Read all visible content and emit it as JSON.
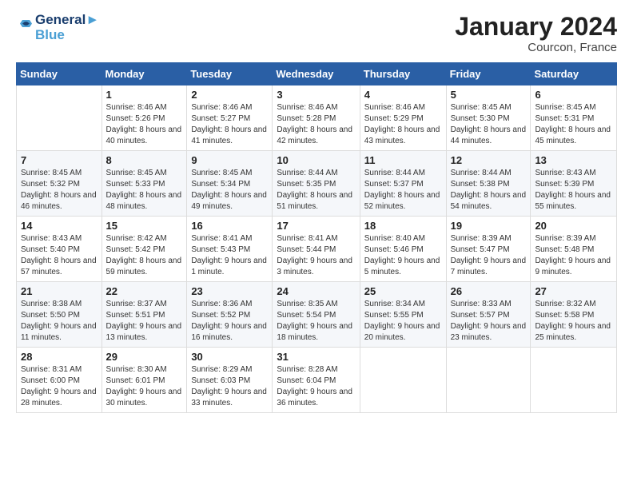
{
  "logo": {
    "line1": "General",
    "line2": "Blue"
  },
  "title": "January 2024",
  "location": "Courcon, France",
  "weekdays": [
    "Sunday",
    "Monday",
    "Tuesday",
    "Wednesday",
    "Thursday",
    "Friday",
    "Saturday"
  ],
  "weeks": [
    [
      {
        "day": "",
        "sunrise": "",
        "sunset": "",
        "daylight": ""
      },
      {
        "day": "1",
        "sunrise": "Sunrise: 8:46 AM",
        "sunset": "Sunset: 5:26 PM",
        "daylight": "Daylight: 8 hours and 40 minutes."
      },
      {
        "day": "2",
        "sunrise": "Sunrise: 8:46 AM",
        "sunset": "Sunset: 5:27 PM",
        "daylight": "Daylight: 8 hours and 41 minutes."
      },
      {
        "day": "3",
        "sunrise": "Sunrise: 8:46 AM",
        "sunset": "Sunset: 5:28 PM",
        "daylight": "Daylight: 8 hours and 42 minutes."
      },
      {
        "day": "4",
        "sunrise": "Sunrise: 8:46 AM",
        "sunset": "Sunset: 5:29 PM",
        "daylight": "Daylight: 8 hours and 43 minutes."
      },
      {
        "day": "5",
        "sunrise": "Sunrise: 8:45 AM",
        "sunset": "Sunset: 5:30 PM",
        "daylight": "Daylight: 8 hours and 44 minutes."
      },
      {
        "day": "6",
        "sunrise": "Sunrise: 8:45 AM",
        "sunset": "Sunset: 5:31 PM",
        "daylight": "Daylight: 8 hours and 45 minutes."
      }
    ],
    [
      {
        "day": "7",
        "sunrise": "Sunrise: 8:45 AM",
        "sunset": "Sunset: 5:32 PM",
        "daylight": "Daylight: 8 hours and 46 minutes."
      },
      {
        "day": "8",
        "sunrise": "Sunrise: 8:45 AM",
        "sunset": "Sunset: 5:33 PM",
        "daylight": "Daylight: 8 hours and 48 minutes."
      },
      {
        "day": "9",
        "sunrise": "Sunrise: 8:45 AM",
        "sunset": "Sunset: 5:34 PM",
        "daylight": "Daylight: 8 hours and 49 minutes."
      },
      {
        "day": "10",
        "sunrise": "Sunrise: 8:44 AM",
        "sunset": "Sunset: 5:35 PM",
        "daylight": "Daylight: 8 hours and 51 minutes."
      },
      {
        "day": "11",
        "sunrise": "Sunrise: 8:44 AM",
        "sunset": "Sunset: 5:37 PM",
        "daylight": "Daylight: 8 hours and 52 minutes."
      },
      {
        "day": "12",
        "sunrise": "Sunrise: 8:44 AM",
        "sunset": "Sunset: 5:38 PM",
        "daylight": "Daylight: 8 hours and 54 minutes."
      },
      {
        "day": "13",
        "sunrise": "Sunrise: 8:43 AM",
        "sunset": "Sunset: 5:39 PM",
        "daylight": "Daylight: 8 hours and 55 minutes."
      }
    ],
    [
      {
        "day": "14",
        "sunrise": "Sunrise: 8:43 AM",
        "sunset": "Sunset: 5:40 PM",
        "daylight": "Daylight: 8 hours and 57 minutes."
      },
      {
        "day": "15",
        "sunrise": "Sunrise: 8:42 AM",
        "sunset": "Sunset: 5:42 PM",
        "daylight": "Daylight: 8 hours and 59 minutes."
      },
      {
        "day": "16",
        "sunrise": "Sunrise: 8:41 AM",
        "sunset": "Sunset: 5:43 PM",
        "daylight": "Daylight: 9 hours and 1 minute."
      },
      {
        "day": "17",
        "sunrise": "Sunrise: 8:41 AM",
        "sunset": "Sunset: 5:44 PM",
        "daylight": "Daylight: 9 hours and 3 minutes."
      },
      {
        "day": "18",
        "sunrise": "Sunrise: 8:40 AM",
        "sunset": "Sunset: 5:46 PM",
        "daylight": "Daylight: 9 hours and 5 minutes."
      },
      {
        "day": "19",
        "sunrise": "Sunrise: 8:39 AM",
        "sunset": "Sunset: 5:47 PM",
        "daylight": "Daylight: 9 hours and 7 minutes."
      },
      {
        "day": "20",
        "sunrise": "Sunrise: 8:39 AM",
        "sunset": "Sunset: 5:48 PM",
        "daylight": "Daylight: 9 hours and 9 minutes."
      }
    ],
    [
      {
        "day": "21",
        "sunrise": "Sunrise: 8:38 AM",
        "sunset": "Sunset: 5:50 PM",
        "daylight": "Daylight: 9 hours and 11 minutes."
      },
      {
        "day": "22",
        "sunrise": "Sunrise: 8:37 AM",
        "sunset": "Sunset: 5:51 PM",
        "daylight": "Daylight: 9 hours and 13 minutes."
      },
      {
        "day": "23",
        "sunrise": "Sunrise: 8:36 AM",
        "sunset": "Sunset: 5:52 PM",
        "daylight": "Daylight: 9 hours and 16 minutes."
      },
      {
        "day": "24",
        "sunrise": "Sunrise: 8:35 AM",
        "sunset": "Sunset: 5:54 PM",
        "daylight": "Daylight: 9 hours and 18 minutes."
      },
      {
        "day": "25",
        "sunrise": "Sunrise: 8:34 AM",
        "sunset": "Sunset: 5:55 PM",
        "daylight": "Daylight: 9 hours and 20 minutes."
      },
      {
        "day": "26",
        "sunrise": "Sunrise: 8:33 AM",
        "sunset": "Sunset: 5:57 PM",
        "daylight": "Daylight: 9 hours and 23 minutes."
      },
      {
        "day": "27",
        "sunrise": "Sunrise: 8:32 AM",
        "sunset": "Sunset: 5:58 PM",
        "daylight": "Daylight: 9 hours and 25 minutes."
      }
    ],
    [
      {
        "day": "28",
        "sunrise": "Sunrise: 8:31 AM",
        "sunset": "Sunset: 6:00 PM",
        "daylight": "Daylight: 9 hours and 28 minutes."
      },
      {
        "day": "29",
        "sunrise": "Sunrise: 8:30 AM",
        "sunset": "Sunset: 6:01 PM",
        "daylight": "Daylight: 9 hours and 30 minutes."
      },
      {
        "day": "30",
        "sunrise": "Sunrise: 8:29 AM",
        "sunset": "Sunset: 6:03 PM",
        "daylight": "Daylight: 9 hours and 33 minutes."
      },
      {
        "day": "31",
        "sunrise": "Sunrise: 8:28 AM",
        "sunset": "Sunset: 6:04 PM",
        "daylight": "Daylight: 9 hours and 36 minutes."
      },
      {
        "day": "",
        "sunrise": "",
        "sunset": "",
        "daylight": ""
      },
      {
        "day": "",
        "sunrise": "",
        "sunset": "",
        "daylight": ""
      },
      {
        "day": "",
        "sunrise": "",
        "sunset": "",
        "daylight": ""
      }
    ]
  ]
}
